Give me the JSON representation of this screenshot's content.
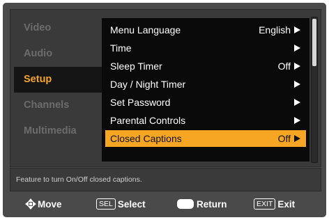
{
  "left_menu": [
    {
      "label": "Video",
      "active": false
    },
    {
      "label": "Audio",
      "active": false
    },
    {
      "label": "Setup",
      "active": true
    },
    {
      "label": "Channels",
      "active": false
    },
    {
      "label": "Multimedia",
      "active": false
    }
  ],
  "setup_menu": [
    {
      "label": "Menu Language",
      "value": "English",
      "selected": false
    },
    {
      "label": "Time",
      "value": "",
      "selected": false
    },
    {
      "label": "Sleep Timer",
      "value": "Off",
      "selected": false
    },
    {
      "label": "Day / Night Timer",
      "value": "",
      "selected": false
    },
    {
      "label": "Set Password",
      "value": "",
      "selected": false
    },
    {
      "label": "Parental Controls",
      "value": "",
      "selected": false
    },
    {
      "label": "Closed Captions",
      "value": "Off",
      "selected": true
    }
  ],
  "help_text": "Feature to turn On/Off closed captions.",
  "nav": {
    "move": "Move",
    "sel_key": "SEL",
    "select": "Select",
    "return": "Return",
    "exit_key": "EXIT",
    "exit": "Exit"
  },
  "colors": {
    "accent": "#f6a623",
    "menu_bg": "#0a0a0a",
    "frame": "#4a4a4a"
  }
}
